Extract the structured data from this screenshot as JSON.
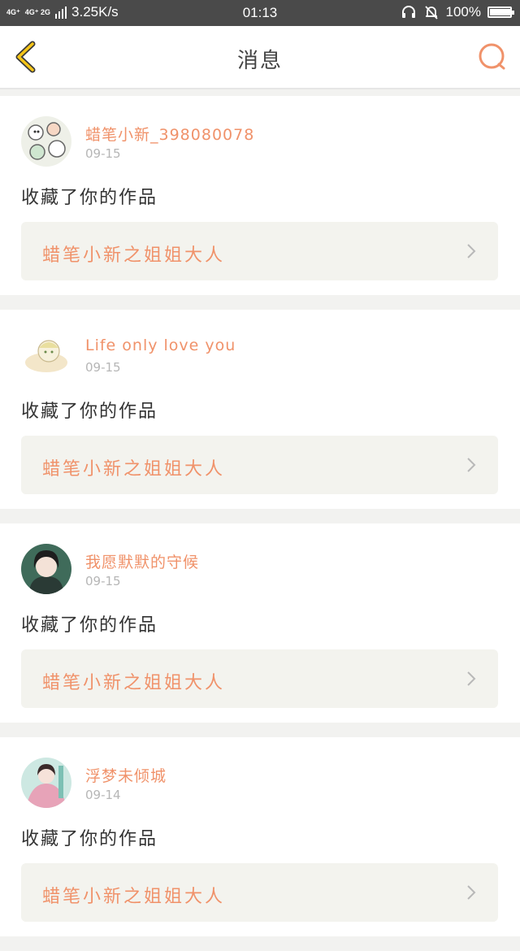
{
  "status_bar": {
    "network_1": "4G⁺",
    "network_2": "4G⁺ 2G",
    "speed": "3.25K/s",
    "time": "01:13",
    "battery": "100%",
    "battery_level": 1.0,
    "icons": [
      "headset-icon",
      "bell-mute-icon",
      "battery-icon"
    ]
  },
  "navbar": {
    "title": "消息",
    "back_icon": "chevron-left-icon",
    "search_icon": "search-icon",
    "accent_color": "#f5a623",
    "search_color": "#f0926a"
  },
  "messages": [
    {
      "username": "蜡笔小新_398080078",
      "date": "09-15",
      "action": "收藏了你的作品",
      "work_title": "蜡笔小新之姐姐大人"
    },
    {
      "username": "Life only love you",
      "date": "09-15",
      "action": "收藏了你的作品",
      "work_title": "蜡笔小新之姐姐大人"
    },
    {
      "username": "我愿默默的守候",
      "date": "09-15",
      "action": "收藏了你的作品",
      "work_title": "蜡笔小新之姐姐大人"
    },
    {
      "username": "浮梦未倾城",
      "date": "09-14",
      "action": "收藏了你的作品",
      "work_title": "蜡笔小新之姐姐大人"
    }
  ]
}
